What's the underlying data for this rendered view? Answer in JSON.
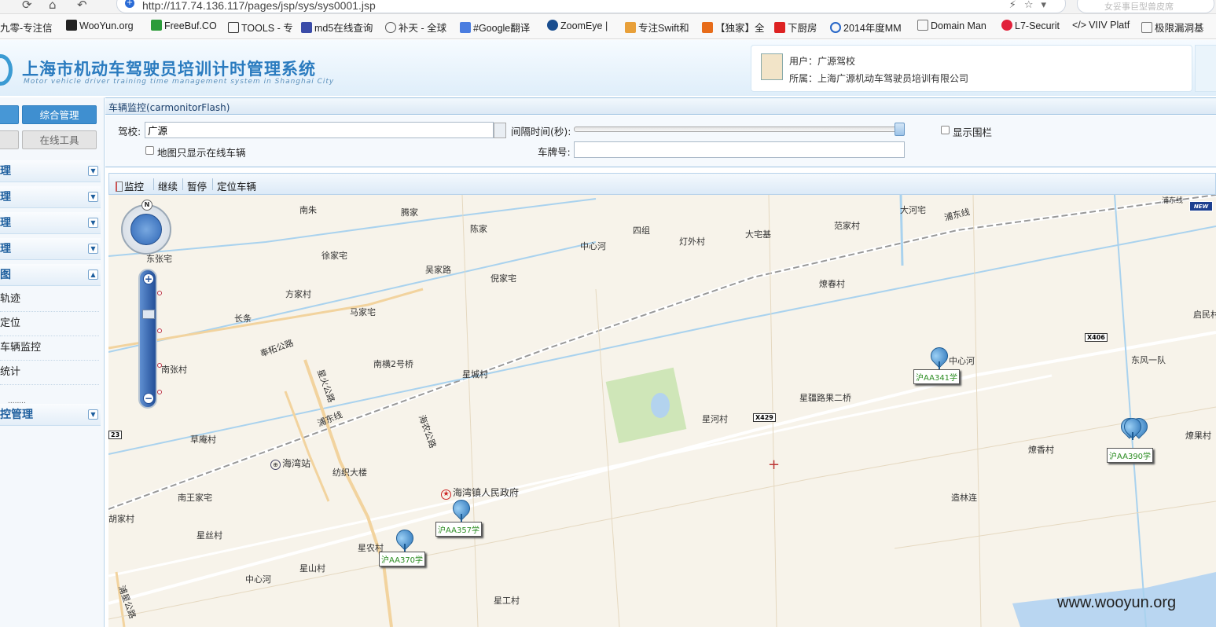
{
  "browser": {
    "url": "http://117.74.136.117/pages/jsp/sys/sys0001.jsp",
    "search_placeholder": "女妥事巨型兽皮席",
    "bookmarks": [
      "九零-专注信",
      "WooYun.org",
      "FreeBuf.CO",
      "TOOLS - 专",
      "md5在线查询",
      "补天 - 全球",
      "#Google翻译",
      "ZoomEye |",
      "专注Swift和",
      "【独家】全",
      "下厨房",
      "2014年度MM",
      "Domain Man",
      "L7-Securit",
      "VIIV Platf",
      "极限漏洞基"
    ]
  },
  "header": {
    "title": "上海市机动车驾驶员培训计时管理系统",
    "subtitle": "Motor vehicle driver training time management system in Shanghai City",
    "user_label": "用户：",
    "user_value": "广源驾校",
    "org_label": "所属：",
    "org_value": "上海广源机动车驾驶员培训有限公司"
  },
  "sidebar": {
    "btn_zonghe": "综合管理",
    "btn_zaixian": "在线工具",
    "sections": [
      "理",
      "理",
      "理",
      "理",
      "图"
    ],
    "items": [
      "轨迹",
      "定位",
      "车辆监控",
      "统计"
    ],
    "bottom_section": "控管理",
    "toggle_collapsed": "▼",
    "toggle_expanded": "▲",
    "dots": "........"
  },
  "panel": {
    "title": "车辆监控(carmonitorFlash)",
    "school_label": "驾校:",
    "school_value": "广源",
    "interval_label": "间隔时间(秒):",
    "fence_label": "显示围栏",
    "online_only_label": "地图只显示在线车辆",
    "plate_label": "车牌号:",
    "plate_value": ""
  },
  "toolbar": {
    "monitor": "监控",
    "continue": "继续",
    "pause": "暂停",
    "locate": "定位车辆"
  },
  "map": {
    "places": [
      "南朱",
      "腾家",
      "陈家",
      "四组",
      "中心河",
      "灯外村",
      "大宅基",
      "范家村",
      "大河宅",
      "浦东线",
      "浦东线",
      "东张宅",
      "徐家宅",
      "吴家路",
      "倪家宅",
      "燎春村",
      "方家村",
      "马家宅",
      "长条",
      "启民村",
      "奉柘公路",
      "南横2号桥",
      "星城村",
      "中心河",
      "东风一队",
      "南张村",
      "星火公路",
      "海农公路",
      "星疆路果二桥",
      "星河村",
      "燎果村",
      "浦东线",
      "草庵村",
      "海湾站",
      "纺织大楼",
      "燎香村",
      "南王家宅",
      "海湾镇人民政府",
      "造林连",
      "胡家村",
      "星丝村",
      "星农村",
      "星山村",
      "中心河",
      "星工村",
      "浦星公路",
      "23",
      "X406",
      "X429",
      "NEW"
    ],
    "cars": [
      "沪AA341学",
      "沪AA357学",
      "沪AA370学",
      "沪AA390学"
    ],
    "compass_letter": "N",
    "zoom_in": "+",
    "zoom_out": "−",
    "center_marker": "+"
  },
  "watermark": "www.wooyun.org"
}
